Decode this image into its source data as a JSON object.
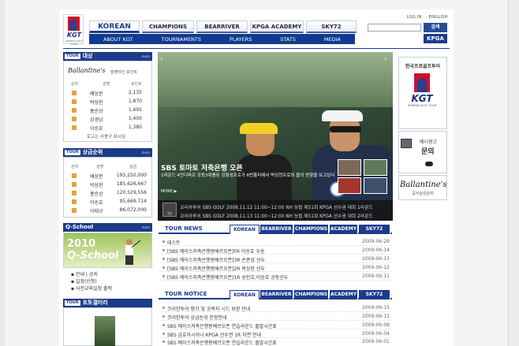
{
  "header": {
    "util_links": [
      "LOG IN",
      "ENGLISH"
    ],
    "search_button": "검색",
    "kpga_button": "KPGA",
    "logo_text": "KGT",
    "logo_sub": "KOREAN GOLF TOUR",
    "tabs": [
      "KOREAN",
      "CHAMPIONS",
      "BEARRIVER",
      "KPGA ACADEMY",
      "SKY72"
    ],
    "menu": [
      "ABOUT KGT",
      "TOURNAMENTS",
      "PLAYERS",
      "STATS",
      "MEDIA"
    ]
  },
  "left": {
    "tour_badge": "TOUR",
    "more": "more",
    "box1": {
      "title": "대상",
      "sponsor": "Ballantine's",
      "sponsor_sub": "발렌타인 포인트",
      "col_rank": "순위",
      "col_name": "성명",
      "col_point": "포인트",
      "rows": [
        {
          "name": "배상문",
          "value": "2,135"
        },
        {
          "name": "박상현",
          "value": "1,870"
        },
        {
          "name": "홍순상",
          "value": "1,695"
        },
        {
          "name": "강경남",
          "value": "1,400"
        },
        {
          "name": "이승호",
          "value": "1,380"
        }
      ],
      "footer": "로고는 사용구 표시임"
    },
    "box2": {
      "title": "상금순위",
      "col_rank": "순위",
      "col_name": "성명",
      "col_money": "상금",
      "rows": [
        {
          "name": "배상문",
          "value": "195,250,000"
        },
        {
          "name": "박상현",
          "value": "185,626,667"
        },
        {
          "name": "홍순상",
          "value": "120,529,556"
        },
        {
          "name": "이승호",
          "value": "95,669,714"
        },
        {
          "name": "이태규",
          "value": "86,072,000"
        }
      ]
    },
    "qschool": {
      "title": "Q-School",
      "year": "2010",
      "banner": "Q-School",
      "links": [
        "안내 | 공지",
        "일정(신청)",
        "사전교육일정 출력"
      ]
    },
    "gallery": {
      "title": "포토갤러리"
    }
  },
  "banner": {
    "headline": "SBS 토마토 저축은행 오픈",
    "caption": "1라운드 4언더파로 공동3위를된 김형성프로가 6번홀티에서 박상현프로와 볼의 방향을 보고있다",
    "more": "MORE ▶",
    "ticker": [
      "코리아투어 SBS GOLF 2008.11.12 11:00~12:00 NH 농협 제51회 KPGA 선수권 대회 1라운드",
      "코리아투어 SBS GOLF 2008.11.13 11:00~12:00 NH 농협 제51회 KPGA 선수권 대회 2라운드"
    ],
    "tv_label": "TV"
  },
  "tour_news": {
    "title": "TOUR NEWS",
    "tabs": [
      "KOREAN",
      "BEARRIVER",
      "CHAMPIONS",
      "ACADEMY",
      "SKY72"
    ],
    "items": [
      {
        "title": "테스트",
        "date": "2009-06-29"
      },
      {
        "title": "[SBS 에이스저축은행몽베르오픈]FR 이승호 우승",
        "date": "2009-06-14"
      },
      {
        "title": "[SBS 에이스저축은행몽베르오픈]3R 손준업 선두",
        "date": "2009-06-13"
      },
      {
        "title": "[SBS 에이스저축은행몽베르오픈]2R 박상현 선두",
        "date": "2009-06-12"
      },
      {
        "title": "[SBS 에이스저축은행몽베르오픈]1R 송민호,이승호 공동선두",
        "date": "2009-06-11"
      }
    ]
  },
  "tour_notice": {
    "title": "TOUR NOTICE",
    "tabs": [
      "KOREAN",
      "BEARRIVER",
      "CHAMPIONS",
      "ACADEMY",
      "SKY72"
    ],
    "items": [
      {
        "title": "코리안투어 평가 및 공복지 시드 보완 안내",
        "date": "2009-06-15"
      },
      {
        "title": "코리안투어 상금순위 안정안내",
        "date": "2009-06-15"
      },
      {
        "title": "SBS 에이스저축은행몽베르오픈 연습라운드 출발시간표",
        "date": "2009-06-08"
      },
      {
        "title": "SBS 금호아시아나 KPGA 선수권 1R 자면 안내",
        "date": "2009-06-04"
      },
      {
        "title": "SBS 에이스저축은행몽베르오픈 연습라운드 출발시간표",
        "date": "2009-06-01"
      }
    ]
  },
  "right": {
    "title": "한국프로골프투어",
    "kgt": "KGT",
    "kgt_sub": "KOREAN GOLF TOUR",
    "ad_line1": "배너광고",
    "ad_line2": "문의",
    "sponsor": "Ballantine's",
    "sponsor_sub": "공식상금순위"
  },
  "colors": {
    "primary": "#1b3c8c",
    "accent_red": "#d0102b",
    "qschool_green": "#9fc35b"
  }
}
